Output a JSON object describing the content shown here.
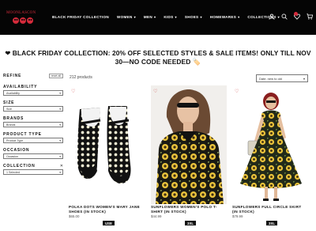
{
  "logo": {
    "text": "MOONLASCON"
  },
  "nav": {
    "items": [
      {
        "label": "BLACK FRIDAY COLLECTION",
        "dropdown": false
      },
      {
        "label": "WOMEN",
        "dropdown": true
      },
      {
        "label": "MEN",
        "dropdown": true
      },
      {
        "label": "KIDS",
        "dropdown": true
      },
      {
        "label": "SHOES",
        "dropdown": true
      },
      {
        "label": "HOMEWARES",
        "dropdown": true
      },
      {
        "label": "COLLECTIONS",
        "dropdown": true
      }
    ],
    "icons": [
      "account-icon",
      "search-icon",
      "wishlist-icon",
      "cart-icon"
    ]
  },
  "banner": {
    "icon": "heart-icon",
    "text": "BLACK FRIDAY COLLECTION: 20% OFF SELECTED STYLES & SALE ITEMS! ONLY TILL NOV 30—NO CODE NEEDED",
    "emoji": "🏷️"
  },
  "sidebar": {
    "refine": "REFINE",
    "reset": "reset all",
    "facets": [
      {
        "title": "AVAILABILITY",
        "value": "Availability",
        "clearable": false
      },
      {
        "title": "SIZE",
        "value": "Size",
        "clearable": false
      },
      {
        "title": "BRANDS",
        "value": "Brands",
        "clearable": false
      },
      {
        "title": "PRODUCT TYPE",
        "value": "Product Type",
        "clearable": false
      },
      {
        "title": "OCCASION",
        "value": "Occasion",
        "clearable": false
      },
      {
        "title": "COLLECTION",
        "value": "1 Selected",
        "clearable": true
      }
    ]
  },
  "results": {
    "count": "212 products",
    "sort": "Date, new to old"
  },
  "products": [
    {
      "title": "POLKA DOTS WOMEN'S MARY JANE SHOES (IN STOCK)",
      "price": "$65.00",
      "size": "US8"
    },
    {
      "title": "SUNFLOWERS WOMEN'S POLO T-SHIRT (IN STOCK)",
      "price": "$44.99",
      "size": "3XL"
    },
    {
      "title": "SUNFLOWERS FULL CIRCLE SKIRT (IN STOCK)",
      "price": "$79.99",
      "size": "3XL"
    }
  ],
  "colors": {
    "brand_red": "#d52b3b",
    "nav_bg": "#050505"
  }
}
